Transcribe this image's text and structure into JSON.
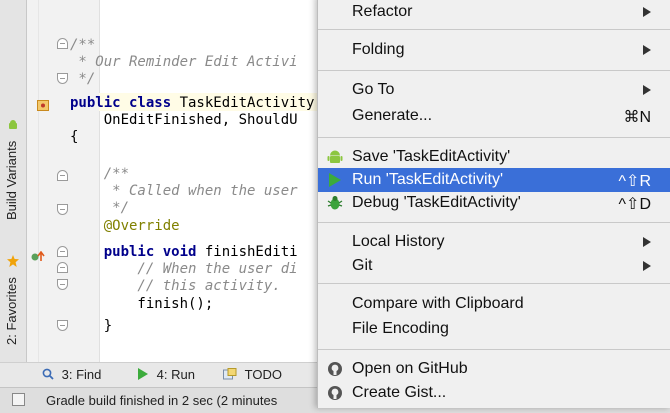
{
  "editor": {
    "lines": [
      {
        "id": "l1",
        "parts": [
          {
            "t": "/**",
            "c": "cmt"
          }
        ]
      },
      {
        "id": "l2",
        "parts": [
          {
            "t": " * Our Reminder Edit Activi",
            "c": "cmt"
          }
        ]
      },
      {
        "id": "l3",
        "parts": [
          {
            "t": " */",
            "c": "cmt"
          }
        ]
      },
      {
        "id": "l4",
        "parts": [
          {
            "t": "public class ",
            "c": "kw"
          },
          {
            "t": "TaskEditActivity",
            "c": ""
          }
        ]
      },
      {
        "id": "l5",
        "parts": [
          {
            "t": "    OnEditFinished, ShouldU",
            "c": ""
          }
        ]
      },
      {
        "id": "l6",
        "parts": [
          {
            "t": "{",
            "c": ""
          }
        ]
      },
      {
        "id": "l7",
        "parts": [
          {
            "t": "",
            "c": ""
          }
        ]
      },
      {
        "id": "l8",
        "parts": [
          {
            "t": "    /**",
            "c": "cmt"
          }
        ]
      },
      {
        "id": "l9",
        "parts": [
          {
            "t": "     * Called when the user",
            "c": "cmt"
          }
        ]
      },
      {
        "id": "l10",
        "parts": [
          {
            "t": "     */",
            "c": "cmt"
          }
        ]
      },
      {
        "id": "l11",
        "parts": [
          {
            "t": "    @Override",
            "c": "ann"
          }
        ]
      },
      {
        "id": "l12",
        "parts": [
          {
            "t": "    public void ",
            "c": "kw"
          },
          {
            "t": "finishEditi",
            "c": ""
          }
        ]
      },
      {
        "id": "l13",
        "parts": [
          {
            "t": "        // When the user di",
            "c": "cmt"
          }
        ]
      },
      {
        "id": "l14",
        "parts": [
          {
            "t": "        // this activity.",
            "c": "cmt"
          }
        ]
      },
      {
        "id": "l15",
        "parts": [
          {
            "t": "        finish();",
            "c": ""
          }
        ]
      },
      {
        "id": "l16",
        "parts": [
          {
            "t": "    }",
            "c": ""
          }
        ]
      }
    ]
  },
  "side_tabs": {
    "build_variants": "Build Variants",
    "favorites": "2: Favorites"
  },
  "toolbar": {
    "find": "3: Find",
    "run": "4: Run",
    "todo": "TODO"
  },
  "status": {
    "text": "Gradle build finished in 2 sec (2 minutes"
  },
  "menu": {
    "refactor": "Refactor",
    "folding": "Folding",
    "goto": "Go To",
    "generate": "Generate...",
    "generate_shortcut": "⌘N",
    "save": "Save 'TaskEditActivity'",
    "run": "Run 'TaskEditActivity'",
    "run_shortcut": "^⇧R",
    "debug": "Debug 'TaskEditActivity'",
    "debug_shortcut": "^⇧D",
    "local_history": "Local History",
    "git": "Git",
    "compare_clipboard": "Compare with Clipboard",
    "file_encoding": "File Encoding",
    "open_github": "Open on GitHub",
    "create_gist": "Create Gist..."
  },
  "colors": {
    "selection": "#3a6fd8",
    "android_green": "#8cc63f",
    "run_green": "#3cab3c",
    "keyword": "#00008b",
    "comment": "#8a8a8a",
    "annotation": "#808000"
  }
}
